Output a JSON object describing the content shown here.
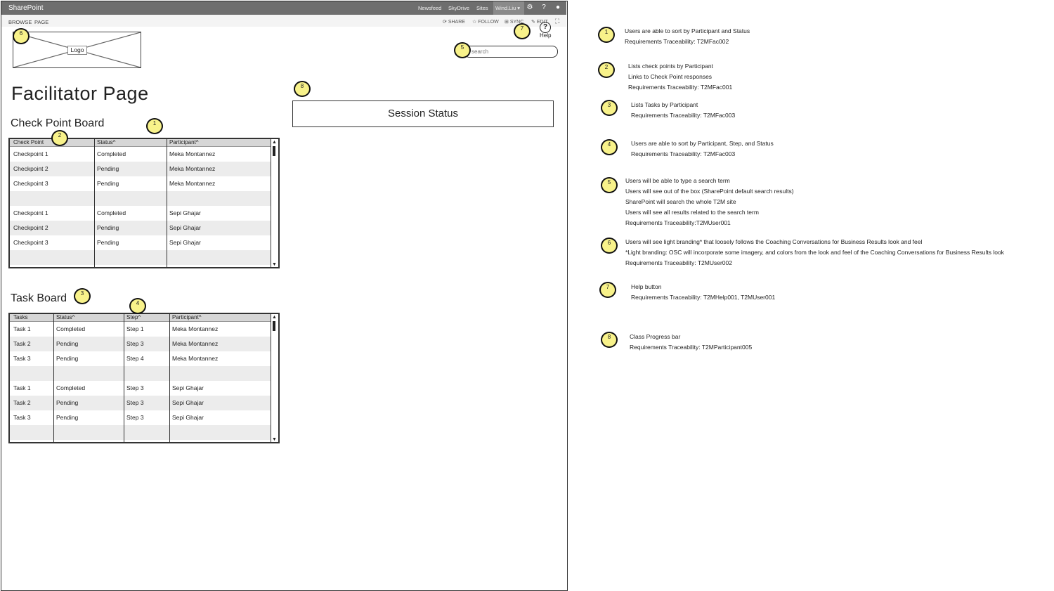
{
  "suite_bar": {
    "brand": "SharePoint",
    "links": [
      "Newsfeed",
      "SkyDrive",
      "Sites"
    ],
    "user": "Wind.Liu ▾",
    "icons": [
      "gear-icon",
      "help-icon",
      "user-icon"
    ]
  },
  "ribbon": {
    "tabs": [
      "BROWSE",
      "PAGE"
    ],
    "actions": [
      "SHARE",
      "FOLLOW",
      "SYNC",
      "EDIT"
    ]
  },
  "logo": {
    "label": "Logo"
  },
  "search": {
    "placeholder": "search"
  },
  "help": {
    "label": "Help"
  },
  "page_title": "Facilitator Page",
  "checkpoint_board": {
    "title": "Check Point Board",
    "columns": [
      "Check Point",
      "Status^",
      "Participant^"
    ],
    "rows": [
      [
        "Checkpoint 1",
        "Completed",
        "Meka Montannez"
      ],
      [
        "Checkpoint 2",
        "Pending",
        "Meka Montannez"
      ],
      [
        "Checkpoint 3",
        "Pending",
        "Meka Montannez"
      ],
      [
        "",
        "",
        ""
      ],
      [
        "Checkpoint 1",
        "Completed",
        "Sepi Ghajar"
      ],
      [
        "Checkpoint 2",
        "Pending",
        "Sepi Ghajar"
      ],
      [
        "Checkpoint 3",
        "Pending",
        "Sepi Ghajar"
      ]
    ]
  },
  "task_board": {
    "title": "Task Board",
    "columns": [
      "Tasks",
      "Status^",
      "Step^",
      "Participant^"
    ],
    "rows": [
      [
        "Task 1",
        "Completed",
        "Step 1",
        "Meka Montannez"
      ],
      [
        "Task 2",
        "Pending",
        "Step 3",
        "Meka Montannez"
      ],
      [
        "Task 3",
        "Pending",
        "Step 4",
        "Meka Montannez"
      ],
      [
        "",
        "",
        "",
        ""
      ],
      [
        "Task 1",
        "Completed",
        "Step 3",
        "Sepi Ghajar"
      ],
      [
        "Task 2",
        "Pending",
        "Step 3",
        "Sepi Ghajar"
      ],
      [
        "Task 3",
        "Pending",
        "Step 3",
        "Sepi Ghajar"
      ]
    ]
  },
  "session_status": {
    "label": "Session Status"
  },
  "markers": [
    "1",
    "2",
    "3",
    "4",
    "5",
    "6",
    "7",
    "8"
  ],
  "annotations": [
    {
      "num": "1",
      "lines": [
        "Users are able to sort by Participant and Status",
        "Requirements Traceability: T2MFac002"
      ]
    },
    {
      "num": "2",
      "lines": [
        "Lists check points by Participant",
        "Links to Check Point responses",
        "Requirements Traceability: T2MFac001"
      ]
    },
    {
      "num": "3",
      "lines": [
        "Lists Tasks by Participant",
        "Requirements Traceability: T2MFac003"
      ]
    },
    {
      "num": "4",
      "lines": [
        "Users are able to sort by Participant, Step, and Status",
        "Requirements Traceability: T2MFac003"
      ]
    },
    {
      "num": "5",
      "lines": [
        "Users will be able to type a search term",
        "Users will see out of the box (SharePoint default search results)",
        "SharePoint will search the whole T2M site",
        "Users will see all results related to the search term",
        "Requirements Traceability:T2MUser001"
      ]
    },
    {
      "num": "6",
      "lines": [
        "Users will see light branding* that  loosely follows the Coaching Conversations for Business Results look and feel",
        "*Light branding:  OSC will incorporate some imagery, and colors from the look and feel of the Coaching Conversations for Business Results look",
        "Requirements Traceability: T2MUser002"
      ]
    },
    {
      "num": "7",
      "lines": [
        "Help button",
        "Requirements Traceability: T2MHelp001, T2MUser001"
      ]
    },
    {
      "num": "8",
      "lines": [
        "Class Progress bar",
        "Requirements Traceability: T2MParticipant005"
      ]
    }
  ]
}
